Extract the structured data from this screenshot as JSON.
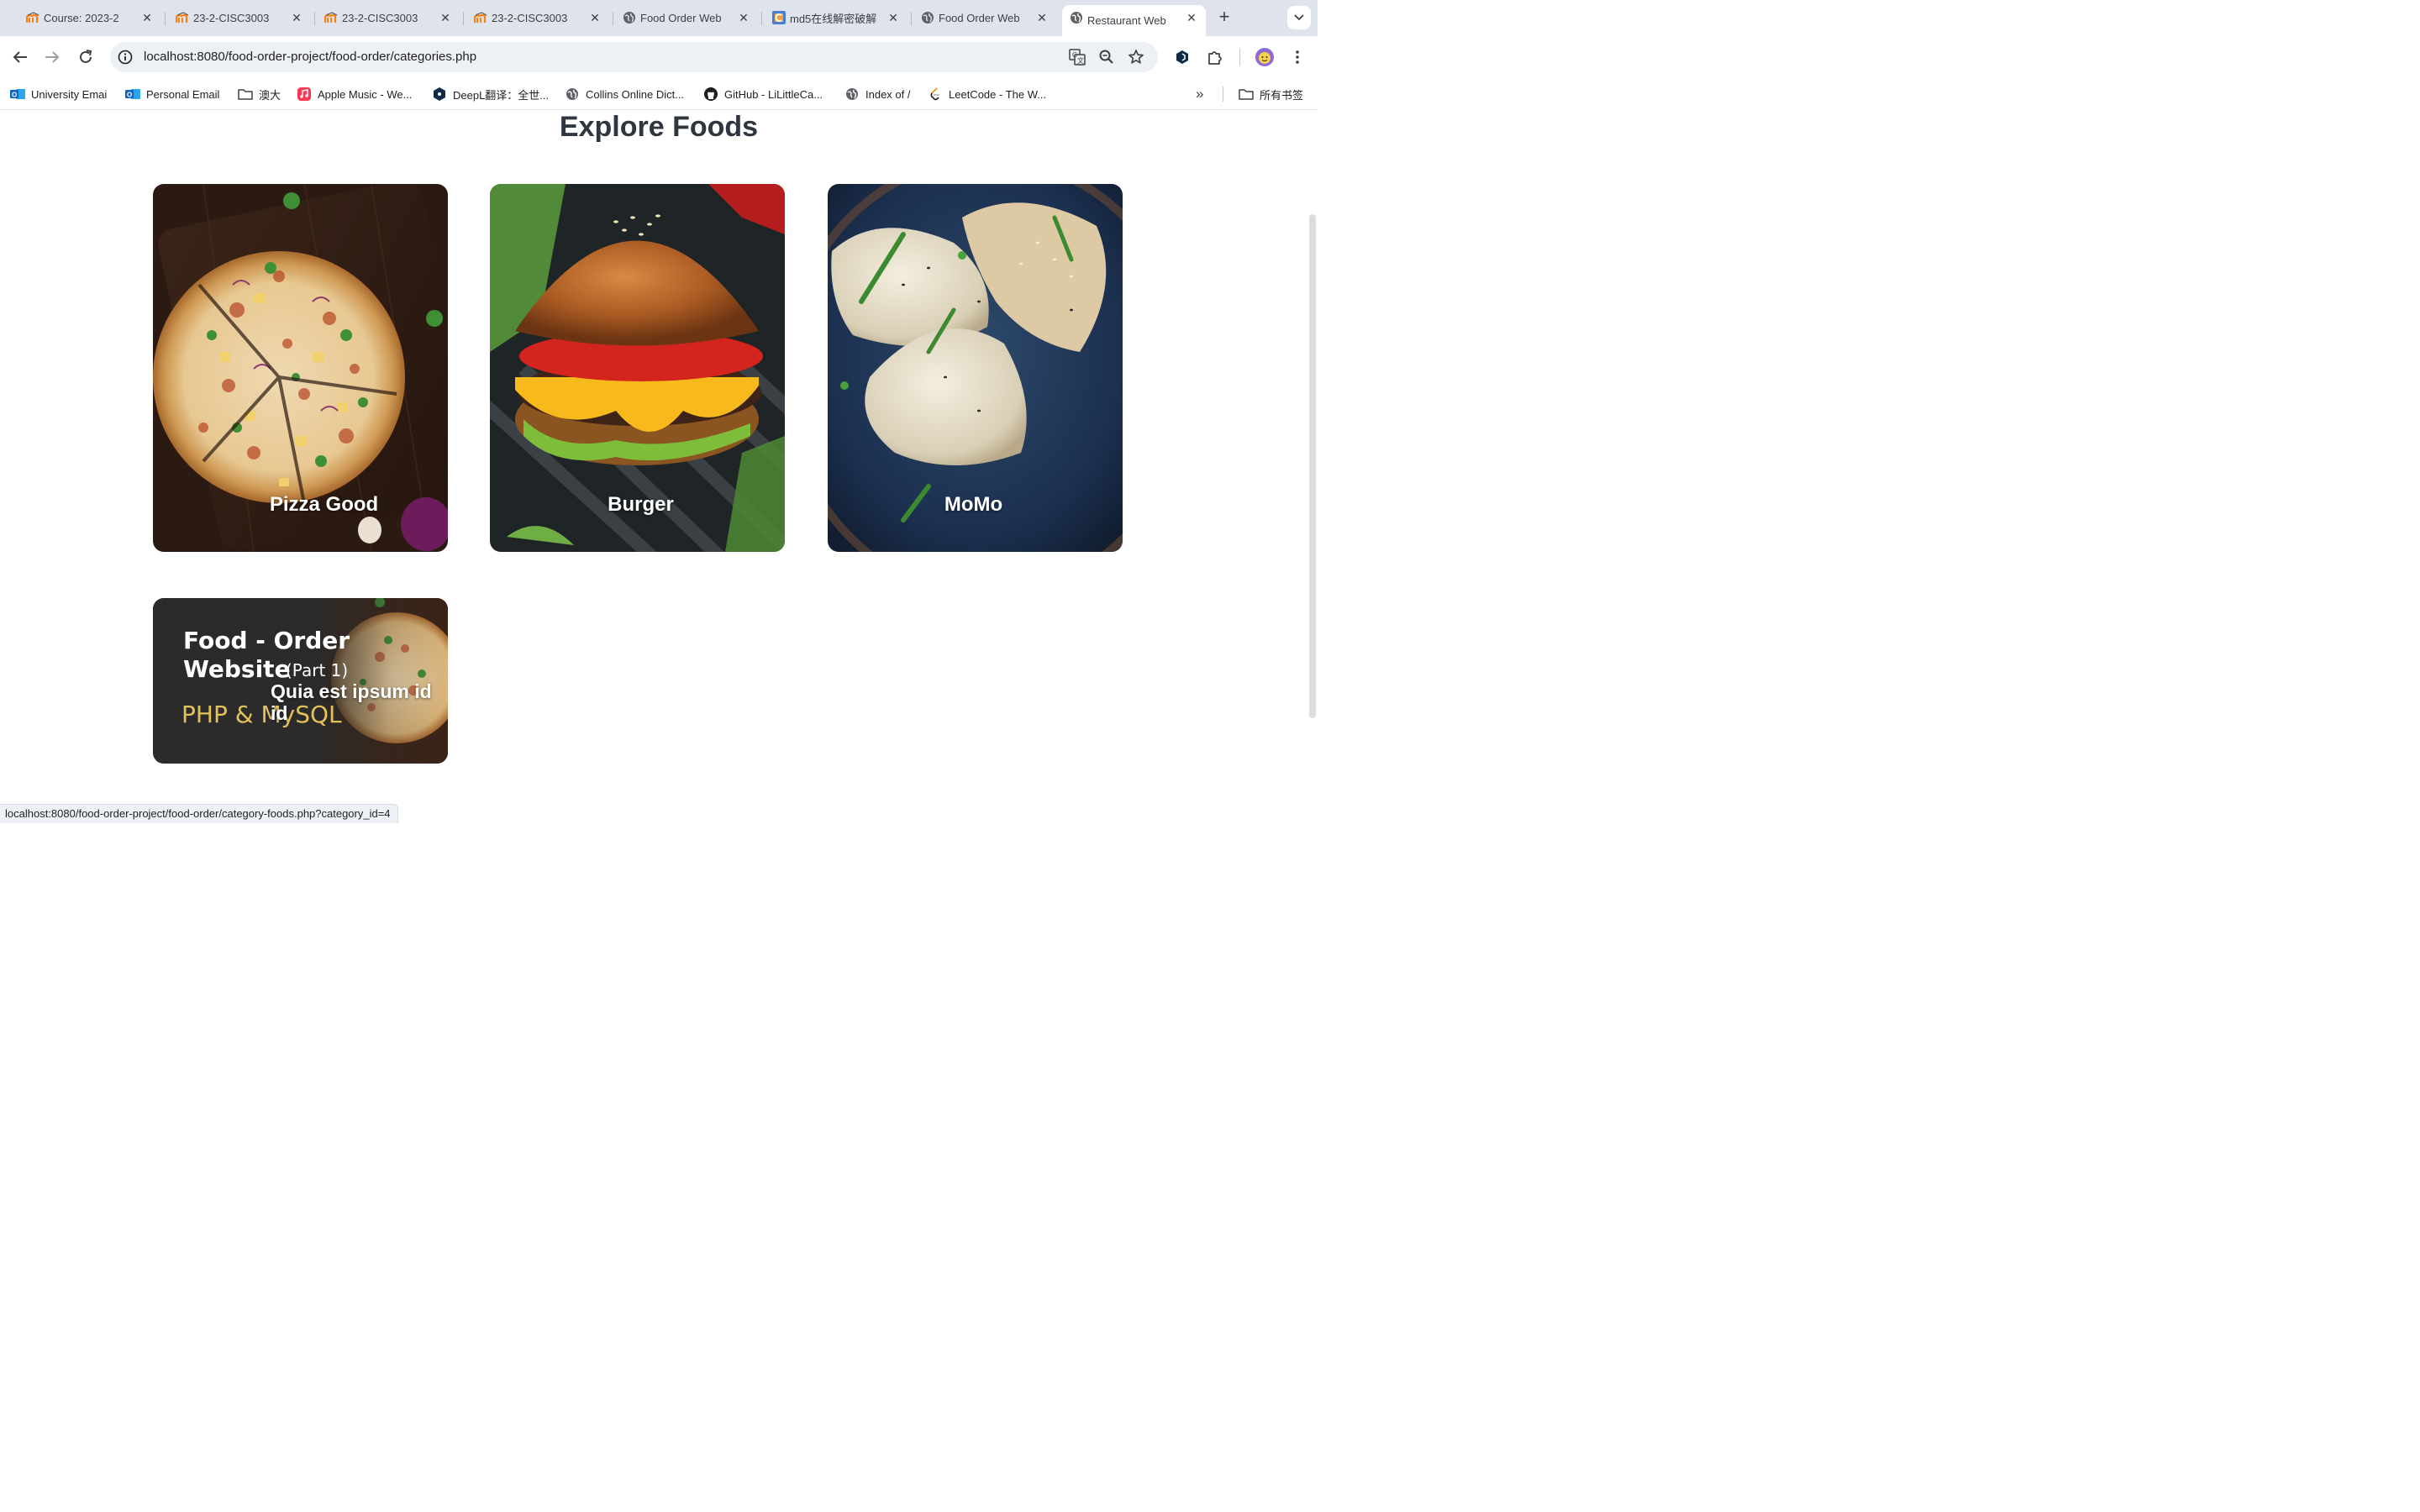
{
  "browser": {
    "tabs": [
      {
        "title": "Course: 2023-2",
        "icon": "moodle-icon",
        "active": false
      },
      {
        "title": "23-2-CISC3003",
        "icon": "moodle-icon",
        "active": false
      },
      {
        "title": "23-2-CISC3003",
        "icon": "moodle-icon",
        "active": false
      },
      {
        "title": "23-2-CISC3003",
        "icon": "moodle-icon",
        "active": false
      },
      {
        "title": "Food Order Web",
        "icon": "globe-icon",
        "active": false
      },
      {
        "title": "md5在线解密破解",
        "icon": "cmd5-icon",
        "active": false
      },
      {
        "title": "Food Order Web",
        "icon": "globe-icon",
        "active": false
      },
      {
        "title": "Restaurant Web",
        "icon": "globe-icon",
        "active": true
      }
    ],
    "new_tab_symbol": "+",
    "tab_search_symbol": "⌄",
    "close_symbol": "✕",
    "url": "localhost:8080/food-order-project/food-order/categories.php",
    "bookmarks": [
      {
        "label": "University Emai",
        "icon": "outlook-icon"
      },
      {
        "label": "Personal Email",
        "icon": "outlook-icon"
      },
      {
        "label": "澳大",
        "icon": "folder-icon"
      },
      {
        "label": "Apple Music - We...",
        "icon": "apple-music-icon"
      },
      {
        "label": "DeepL翻译：全世...",
        "icon": "deepl-icon"
      },
      {
        "label": "Collins Online Dict...",
        "icon": "globe-icon"
      },
      {
        "label": "GitHub - LiLittleCa...",
        "icon": "github-icon"
      },
      {
        "label": "Index of /",
        "icon": "globe-icon"
      },
      {
        "label": "LeetCode - The W...",
        "icon": "leetcode-icon"
      }
    ],
    "bookmarks_overflow_symbol": "»",
    "all_bookmarks_label": "所有书签",
    "status_url": "localhost:8080/food-order-project/food-order/category-foods.php?category_id=4"
  },
  "page": {
    "heading": "Explore Foods",
    "categories": [
      {
        "name": "Pizza Good",
        "image": "pizza-image"
      },
      {
        "name": "Burger",
        "image": "burger-image"
      },
      {
        "name": "MoMo",
        "image": "momo-image"
      },
      {
        "name": "Quia est ipsum id id",
        "image": "food-order-website-thumbnail"
      }
    ],
    "thumbnail": {
      "line1": "Food - Order",
      "line2": "Website",
      "part": "(Part 1)",
      "tech": "PHP & MySQL"
    }
  },
  "colors": {
    "tabstrip": "#dfe3ec",
    "omnibox": "#edf0f5",
    "heading": "#2f3640",
    "thumbnail_bg": "#2b2b2b",
    "thumbnail_accent": "#e2c15a"
  }
}
